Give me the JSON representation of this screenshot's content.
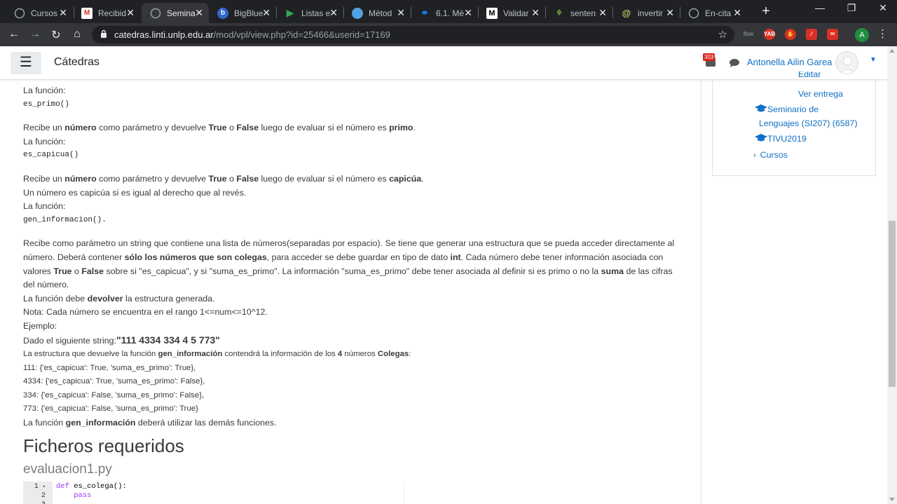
{
  "browser": {
    "tabs": [
      {
        "title": "Cursos",
        "icon": "globe-icon"
      },
      {
        "title": "Recibid",
        "icon": "gmail-icon"
      },
      {
        "title": "Semina",
        "icon": "globe-icon",
        "active": true
      },
      {
        "title": "BigBlue",
        "icon": "bigbluebutton-icon"
      },
      {
        "title": "Listas e",
        "icon": "play-icon"
      },
      {
        "title": "Métod",
        "icon": "circle-icon"
      },
      {
        "title": "6.1. Mé",
        "icon": "doc-icon"
      },
      {
        "title": "Validar",
        "icon": "medium-icon"
      },
      {
        "title": "senten",
        "icon": "leaf-icon"
      },
      {
        "title": "invertir",
        "icon": "swirl-icon"
      },
      {
        "title": "En-cita",
        "icon": "globe-icon"
      }
    ],
    "new_tab": "+",
    "url_host": "catedras.linti.unlp.edu.ar",
    "url_path": "/mod/vpl/view.php?id=25466&userid=17169",
    "extensions": [
      {
        "name": "flow",
        "label": "flow",
        "color": "#35363a"
      },
      {
        "name": "yab",
        "label": "YAB",
        "color": "#d93025"
      },
      {
        "name": "adblock",
        "label": "✋",
        "color": "#d93025"
      },
      {
        "name": "pdf",
        "label": "⁄",
        "color": "#d93025"
      },
      {
        "name": "mail",
        "label": "✉",
        "color": "#d93025"
      }
    ],
    "profile_initial": "A"
  },
  "navbar": {
    "brand": "Cátedras",
    "notif_count": "303",
    "username": "Antonella Ailin Garea"
  },
  "content": {
    "p1_label": "La función:",
    "p1_code": "es_primo()",
    "p2_text_a": "Recibe un ",
    "p2_b1": "número",
    "p2_text_b": " como parámetro y devuelve ",
    "p2_b2": "True",
    "p2_text_c": " o ",
    "p2_b3": "False",
    "p2_text_d": " luego de evaluar si el número es ",
    "p2_b4": "primo",
    "p2_text_e": ".",
    "p2_label": "La función:",
    "p2_code": "es_capicua()",
    "p3_text_a": "Recibe un ",
    "p3_b1": "número",
    "p3_text_b": " como parámetro y devuelve ",
    "p3_b2": "True",
    "p3_text_c": " o ",
    "p3_b3": "False",
    "p3_text_d": " luego de evaluar si el número es ",
    "p3_b4": "capicúa",
    "p3_text_e": ".",
    "p3_line2": "Un número es capicúa si es igual al derecho que al revés.",
    "p3_label": "La función:",
    "p3_code": "gen_informacion().",
    "p4_a": "Recibe como parámetro un string que contiene una lista de números(separadas por espacio).  Se tiene que  generar una estructura que se pueda acceder directamente al número. Deberá contener ",
    "p4_b1": "sólo los números que son colegas",
    "p4_c": ", para acceder se debe guardar en tipo de dato ",
    "p4_b2": "int",
    "p4_d": ". Cada número debe tener información asociada con valores ",
    "p4_b3": "True",
    "p4_e": " o ",
    "p4_b4": "False",
    "p4_f": " sobre si \"es_capicua\", y si \"suma_es_primo\". La información \"suma_es_primo\" debe tener asociada al definir si es primo o no la ",
    "p4_b5": "suma",
    "p4_g": " de las cifras del número.",
    "p4_line2a": "La función debe ",
    "p4_line2b": "devolver",
    "p4_line2c": " la estructura generada.",
    "p4_nota": "Nota: Cada número se encuentra en el rango 1<=num<=10^12.",
    "p4_ejemplo": "Ejemplo:",
    "p4_dado": "Dado el siguiente string:",
    "p4_string": "\"111 4334 334 4 5 773\"",
    "p4_estr_a": "La estructura que devuelve la función ",
    "p4_estr_b": "gen_información",
    "p4_estr_c": " contendrá la información de los ",
    "p4_estr_d": "4",
    "p4_estr_e": " números ",
    "p4_estr_f": "Colegas",
    "p4_estr_g": ":",
    "r1": "111: {'es_capicua': True, 'suma_es_primo': True},",
    "r2": "4334: {'es_capicua': True, 'suma_es_primo': False},",
    "r3": "334: {'es_capicua': False, 'suma_es_primo': False},",
    "r4": "773: {'es_capicua': False, 'suma_es_primo': True}",
    "final_a": "La función ",
    "final_b": "gen_información",
    "final_c": " deberá utilizar las demás funciones."
  },
  "files": {
    "heading": "Ficheros requeridos",
    "filename": "evaluacion1.py",
    "lines": [
      {
        "no": "1",
        "kw": "def",
        "rest": " es_colega():"
      },
      {
        "no": "2",
        "kw": "",
        "rest": "    pass"
      }
    ]
  },
  "sidebar": {
    "editar": "Editar",
    "ver_entrega": "Ver entrega",
    "seminario_1": "Seminario de",
    "seminario_2": "Lenguajes (SI207) (6587)",
    "tivu": "TIVU2019",
    "cursos": "Cursos"
  }
}
